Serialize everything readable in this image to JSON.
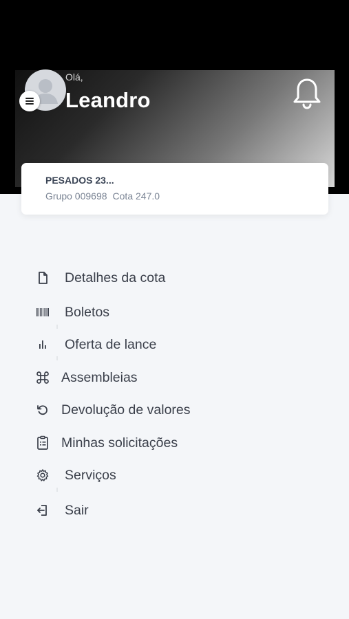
{
  "header": {
    "greeting": "Olá,",
    "user_name": "Leandro"
  },
  "quota_card": {
    "title": "PESADOS 23...",
    "group": "Grupo 009698",
    "quota": "Cota 247.0"
  },
  "menu": {
    "items": [
      {
        "label": "Detalhes da cota",
        "icon": "document-icon"
      },
      {
        "label": "Boletos",
        "icon": "barcode-icon"
      },
      {
        "label": "Oferta de lance",
        "icon": "bar-chart-icon"
      },
      {
        "label": "Assembleias",
        "icon": "command-icon"
      },
      {
        "label": "Devolução de valores",
        "icon": "refresh-icon"
      },
      {
        "label": "Minhas solicitações",
        "icon": "clipboard-list-icon"
      },
      {
        "label": "Serviços",
        "icon": "gear-icon"
      },
      {
        "label": "Sair",
        "icon": "logout-icon"
      }
    ]
  },
  "colors": {
    "background": "#f4f6f9",
    "text": "#3a3f4a",
    "card_title": "#3b4556",
    "card_sub": "#7a8494"
  }
}
